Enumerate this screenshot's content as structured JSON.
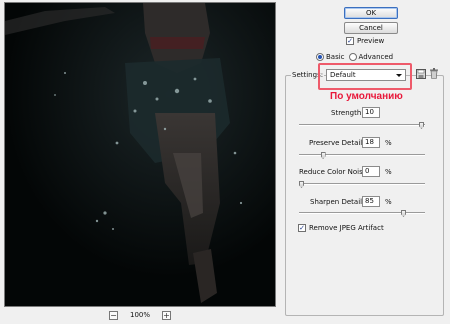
{
  "buttons": {
    "ok": "OK",
    "cancel": "Cancel"
  },
  "preview": {
    "label": "Preview",
    "checked": true
  },
  "mode": {
    "basic": "Basic",
    "advanced": "Advanced",
    "selected": "basic"
  },
  "settings": {
    "label": "Settings:",
    "value": "Default"
  },
  "annotation": "По умолчанию",
  "controls": {
    "strength": {
      "label": "Strength:",
      "value": "10",
      "unit": "",
      "level": 1.0
    },
    "preserve_details": {
      "label": "Preserve Details:",
      "value": "18",
      "unit": "%",
      "level": 0.18
    },
    "reduce_color_noise": {
      "label": "Reduce Color Noise:",
      "value": "0",
      "unit": "%",
      "level": 0.0
    },
    "sharpen_details": {
      "label": "Sharpen Details:",
      "value": "85",
      "unit": "%",
      "level": 0.85
    }
  },
  "remove_jpeg": {
    "label": "Remove JPEG Artifact",
    "checked": true
  },
  "zoom": {
    "value": "100%",
    "minus": "−",
    "plus": "+"
  },
  "icons": {
    "save": "save-settings-icon",
    "delete": "delete-settings-icon"
  },
  "colors": {
    "annotation": "#e8173a",
    "highlight": "#ee5a6a",
    "preview_bg": "#050808"
  }
}
